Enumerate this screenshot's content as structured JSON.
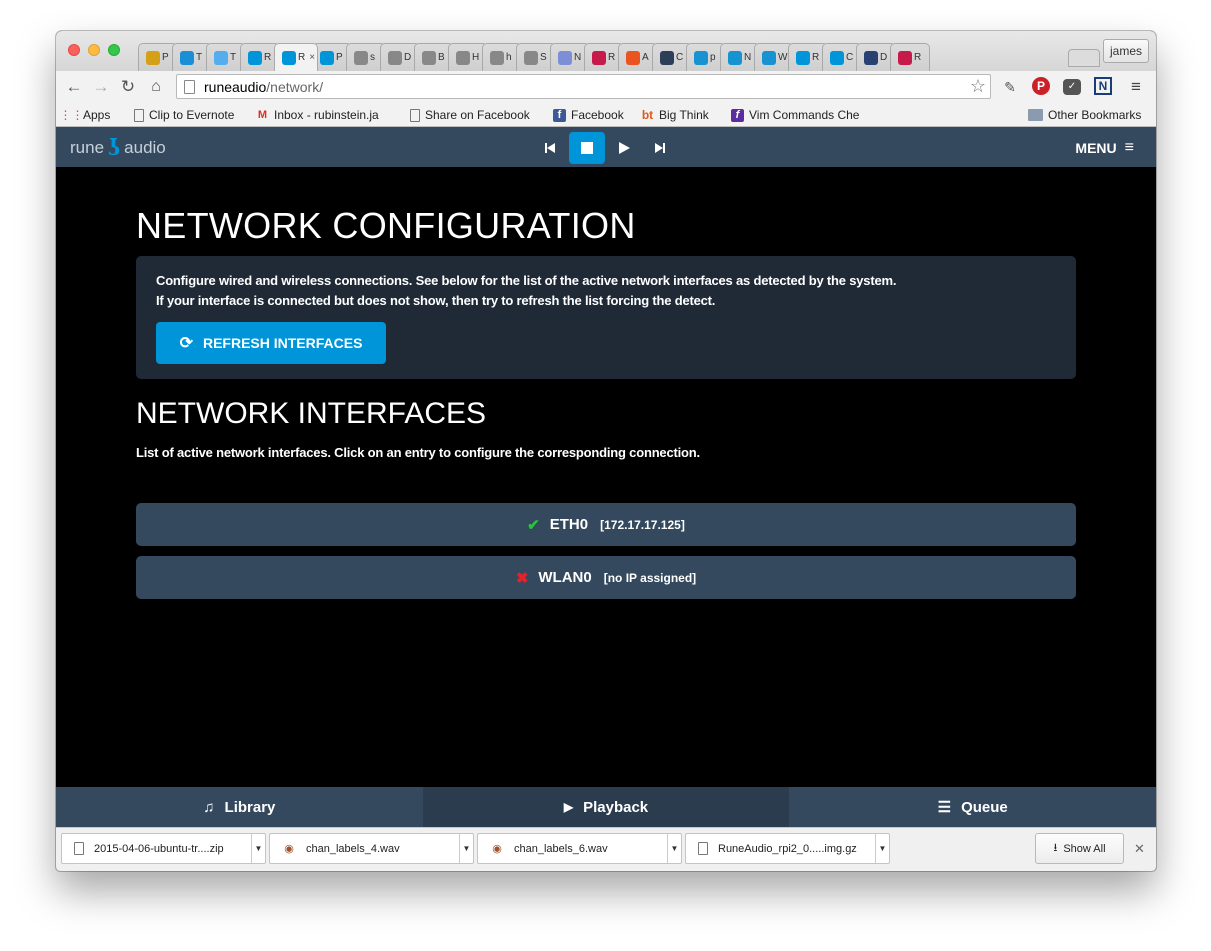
{
  "browser": {
    "profile_name": "james",
    "tabs": [
      {
        "initial": "P",
        "icon": "ghost-icon",
        "color": "#d4a017"
      },
      {
        "initial": "T",
        "icon": "play-circle-icon",
        "color": "#1a8fd6"
      },
      {
        "initial": "T",
        "icon": "twitter-icon",
        "color": "#55acee"
      },
      {
        "initial": "R",
        "icon": "rune-icon",
        "color": "#0095d8"
      },
      {
        "initial": "R",
        "icon": "rune-icon",
        "color": "#0095d8",
        "active": true,
        "close": "×"
      },
      {
        "initial": "P",
        "icon": "rune-icon",
        "color": "#0095d8"
      },
      {
        "initial": "s",
        "icon": "document-icon",
        "color": "#888888"
      },
      {
        "initial": "D",
        "icon": "document-icon",
        "color": "#888888"
      },
      {
        "initial": "B",
        "icon": "document-icon",
        "color": "#888888"
      },
      {
        "initial": "H",
        "icon": "document-icon",
        "color": "#888888"
      },
      {
        "initial": "h",
        "icon": "document-icon",
        "color": "#888888"
      },
      {
        "initial": "S",
        "icon": "document-icon",
        "color": "#888888"
      },
      {
        "initial": "N",
        "icon": "target-icon",
        "color": "#7b8ed6"
      },
      {
        "initial": "R",
        "icon": "raspberry-icon",
        "color": "#c51a4a"
      },
      {
        "initial": "A",
        "icon": "ubuntu-icon",
        "color": "#e95420"
      },
      {
        "initial": "C",
        "icon": "i-circle-icon",
        "color": "#2d3f58"
      },
      {
        "initial": "p",
        "icon": "arch-icon",
        "color": "#1793d1"
      },
      {
        "initial": "N",
        "icon": "arch-icon",
        "color": "#1793d1"
      },
      {
        "initial": "W",
        "icon": "arch-icon",
        "color": "#1793d1"
      },
      {
        "initial": "R",
        "icon": "rune-icon",
        "color": "#0095d8"
      },
      {
        "initial": "C",
        "icon": "rune-icon",
        "color": "#0095d8"
      },
      {
        "initial": "D",
        "icon": "dnf-icon",
        "color": "#294172"
      },
      {
        "initial": "R",
        "icon": "raspberry-icon",
        "color": "#c51a4a"
      }
    ],
    "url_host": "runeaudio",
    "url_path": "/network/",
    "bookmarks": [
      {
        "label": "Apps",
        "icon": "apps-grid-icon"
      },
      {
        "label": "Clip to Evernote",
        "icon": "document-icon"
      },
      {
        "label": "Inbox - rubinstein.ja",
        "icon": "gmail-icon"
      },
      {
        "label": "Share on Facebook",
        "icon": "document-icon"
      },
      {
        "label": "Facebook",
        "icon": "facebook-icon"
      },
      {
        "label": "Big Think",
        "icon": "bigthink-icon"
      },
      {
        "label": "Vim Commands Che",
        "icon": "vim-icon"
      },
      {
        "label": "Other Bookmarks",
        "icon": "folder-icon"
      }
    ]
  },
  "app": {
    "logo_left": "rune",
    "logo_right": "audio",
    "menu_label": "MENU"
  },
  "page": {
    "title": "NETWORK CONFIGURATION",
    "intro_line1": "Configure wired and wireless connections. See below for the list of the active network interfaces as detected by the system.",
    "intro_line2": "If your interface is connected but does not show, then try to refresh the list forcing the detect.",
    "refresh_label": "REFRESH INTERFACES",
    "interfaces_title": "NETWORK INTERFACES",
    "interfaces_sub": "List of active network interfaces. Click on an entry to configure the corresponding connection.",
    "interfaces": [
      {
        "status_glyph": "✔",
        "status": "connected",
        "name": "ETH0",
        "ip": "[172.17.17.125]"
      },
      {
        "status_glyph": "✖",
        "status": "disconnected",
        "name": "WLAN0",
        "ip": "[no IP assigned]"
      }
    ]
  },
  "footer": {
    "library": "Library",
    "playback": "Playback",
    "queue": "Queue"
  },
  "downloads": {
    "items": [
      {
        "name": "2015-04-06-ubuntu-tr....zip",
        "icon": "document-icon"
      },
      {
        "name": "chan_labels_4.wav",
        "icon": "audio-file-icon"
      },
      {
        "name": "chan_labels_6.wav",
        "icon": "audio-file-icon"
      },
      {
        "name": "RuneAudio_rpi2_0.....img.gz",
        "icon": "document-icon"
      }
    ],
    "show_all": "Show All"
  },
  "colors": {
    "header_bg": "#34495e",
    "accent": "#0095d8",
    "well_bg": "#1f2a36",
    "ok": "#27c33a",
    "error": "#e8202a"
  }
}
